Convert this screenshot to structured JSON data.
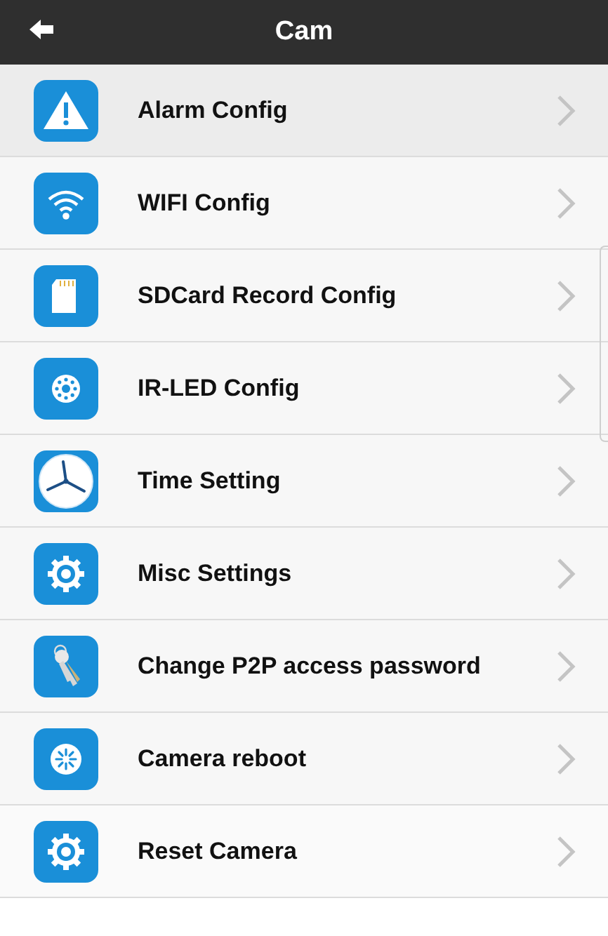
{
  "header": {
    "title": "Cam"
  },
  "items": [
    {
      "label": "Alarm Config"
    },
    {
      "label": "WIFI Config"
    },
    {
      "label": "SDCard Record Config"
    },
    {
      "label": "IR-LED Config"
    },
    {
      "label": "Time Setting"
    },
    {
      "label": "Misc Settings"
    },
    {
      "label": "Change P2P access password"
    },
    {
      "label": "Camera reboot"
    },
    {
      "label": "Reset Camera"
    }
  ]
}
